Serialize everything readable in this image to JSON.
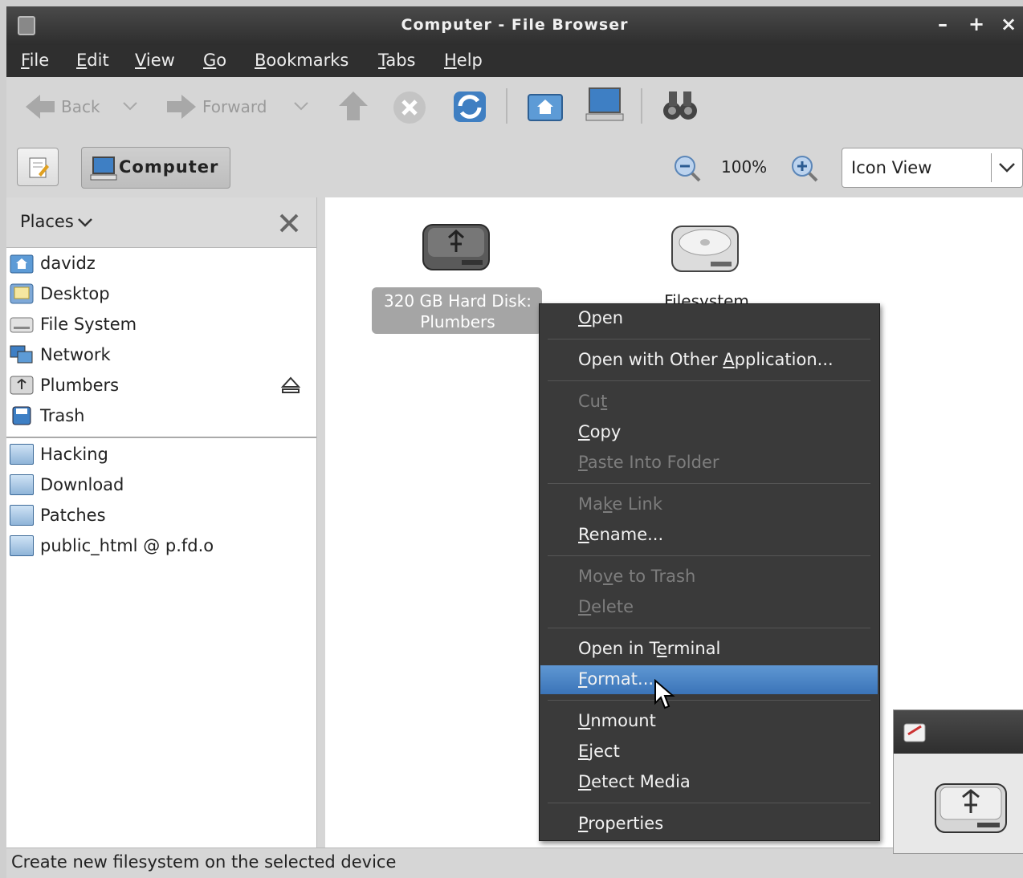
{
  "window": {
    "title": "Computer - File Browser",
    "controls": {
      "minimize": "–",
      "maximize": "+",
      "close": "×"
    }
  },
  "menubar": {
    "items": [
      {
        "first": "F",
        "rest": "ile"
      },
      {
        "first": "E",
        "rest": "dit"
      },
      {
        "first": "V",
        "rest": "iew"
      },
      {
        "first": "G",
        "rest": "o"
      },
      {
        "first": "B",
        "rest": "ookmarks"
      },
      {
        "first": "T",
        "rest": "abs"
      },
      {
        "first": "H",
        "rest": "elp"
      }
    ]
  },
  "toolbar": {
    "back_label": "Back",
    "forward_label": "Forward"
  },
  "locationbar": {
    "computer_label": "Computer",
    "zoom_value": "100%",
    "view_select": "Icon View"
  },
  "sidebar": {
    "header": "Places",
    "places": [
      {
        "label": "davidz",
        "icon": "home-folder-icon"
      },
      {
        "label": "Desktop",
        "icon": "desktop-icon"
      },
      {
        "label": "File System",
        "icon": "filesystem-icon"
      },
      {
        "label": "Network",
        "icon": "network-icon"
      },
      {
        "label": "Plumbers",
        "icon": "usb-drive-icon"
      },
      {
        "label": "Trash",
        "icon": "trash-icon"
      }
    ],
    "bookmarks": [
      {
        "label": "Hacking"
      },
      {
        "label": "Download"
      },
      {
        "label": "Patches"
      },
      {
        "label": "public_html @ p.fd.o"
      }
    ]
  },
  "content": {
    "items": [
      {
        "label_line1": "320 GB Hard Disk:",
        "label_line2": "Plumbers",
        "selected": true
      },
      {
        "label_line1": "Filesystem",
        "selected": false
      }
    ]
  },
  "context_menu": {
    "items": [
      {
        "pre": "",
        "u": "O",
        "post": "pen",
        "disabled": false
      },
      {
        "pre": "Open with Other ",
        "u": "A",
        "post": "pplication...",
        "disabled": false
      },
      {
        "pre": "Cu",
        "u": "t",
        "post": "",
        "disabled": true
      },
      {
        "pre": "",
        "u": "C",
        "post": "opy",
        "disabled": false
      },
      {
        "pre": "",
        "u": "P",
        "post": "aste Into Folder",
        "disabled": true
      },
      {
        "pre": "Ma",
        "u": "k",
        "post": "e Link",
        "disabled": true
      },
      {
        "pre": "",
        "u": "R",
        "post": "ename...",
        "disabled": false
      },
      {
        "pre": "Mo",
        "u": "v",
        "post": "e to Trash",
        "disabled": true
      },
      {
        "pre": "",
        "u": "D",
        "post": "elete",
        "disabled": true
      },
      {
        "pre": "Open in T",
        "u": "e",
        "post": "rminal",
        "disabled": false
      },
      {
        "pre": "",
        "u": "F",
        "post": "ormat...",
        "disabled": false,
        "highlighted": true
      },
      {
        "pre": "",
        "u": "U",
        "post": "nmount",
        "disabled": false
      },
      {
        "pre": "",
        "u": "E",
        "post": "ject",
        "disabled": false
      },
      {
        "pre": "",
        "u": "D",
        "post": "etect Media",
        "disabled": false
      },
      {
        "pre": "",
        "u": "P",
        "post": "roperties",
        "disabled": false
      }
    ]
  },
  "statusbar": {
    "text": "Create new filesystem on the selected device"
  },
  "colors": {
    "highlight": "#4a86c8",
    "menu_bg": "#3a3a3a",
    "titlebar_bg": "#333333"
  }
}
